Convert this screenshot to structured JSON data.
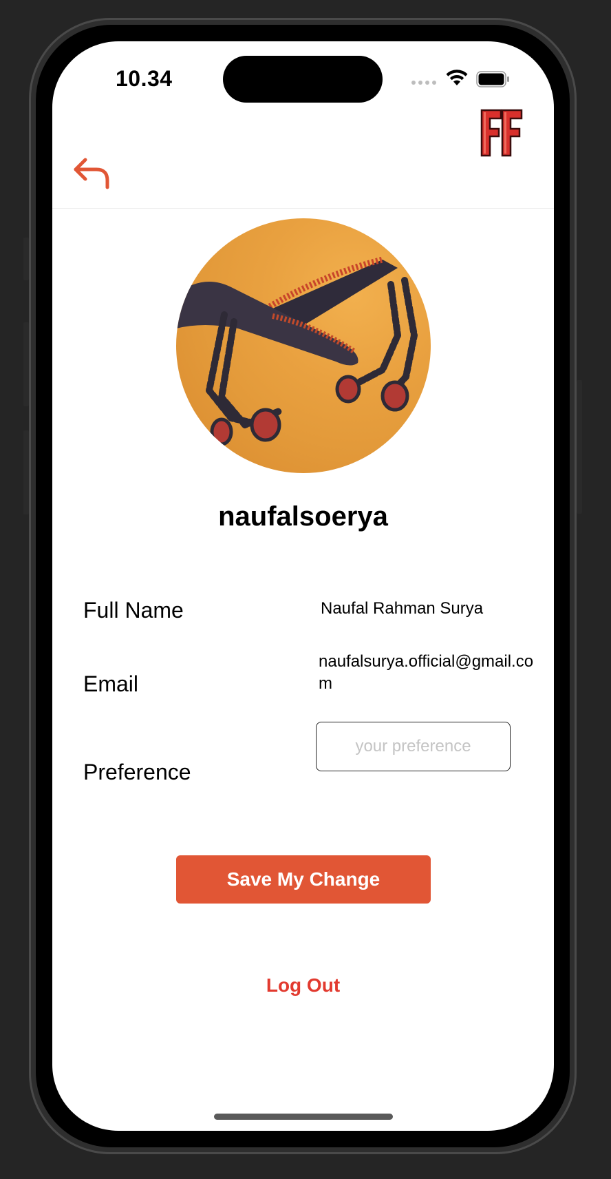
{
  "status_bar": {
    "time": "10.34",
    "wifi_icon": "wifi-icon",
    "battery_icon": "battery-icon"
  },
  "nav": {
    "back_icon": "back-arrow-icon",
    "logo_text": "FF",
    "logo_color": "#d9302c"
  },
  "profile": {
    "username": "naufalsoerya",
    "avatar_description": "profile-photo"
  },
  "fields": {
    "full_name_label": "Full Name",
    "full_name_value": "Naufal Rahman Surya",
    "email_label": "Email",
    "email_value": "naufalsurya.official@gmail.com",
    "preference_label": "Preference",
    "preference_value": "",
    "preference_placeholder": "your preference"
  },
  "actions": {
    "save_label": "Save My Change",
    "logout_label": "Log Out",
    "accent_color": "#e15635",
    "logout_color": "#e23a2f"
  }
}
